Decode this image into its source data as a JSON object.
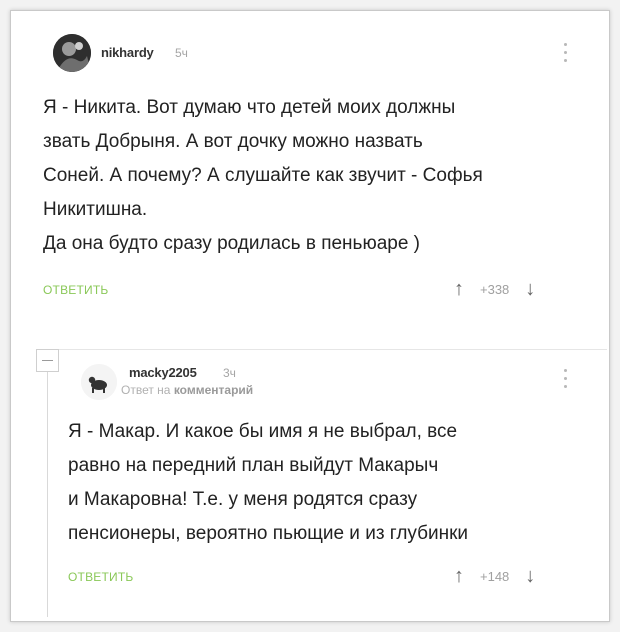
{
  "comments": [
    {
      "username": "nikhardy",
      "time": "5ч",
      "lines": [
        "Я - Никита. Вот думаю что детей моих должны",
        "звать Добрыня. А вот дочку можно назвать",
        "Соней. А почему? А слушайте как звучит - Софья",
        "Никитишна.",
        "Да она будто сразу родилась в пеньюаре )"
      ],
      "reply_label": "ОТВЕТИТЬ",
      "score": "+338",
      "avatar_icon": "user-avatar"
    },
    {
      "username": "macky2205",
      "time": "3ч",
      "reply_to_prefix": "Ответ на",
      "reply_to_target": "комментарий",
      "lines": [
        "Я - Макар. И какое бы имя я не выбрал, все",
        "равно на передний план выйдут Макарыч",
        "и Макаровна! Т.е. у меня родятся сразу",
        "пенсионеры, вероятно пьющие и из глубинки"
      ],
      "reply_label": "ОТВЕТИТЬ",
      "score": "+148",
      "avatar_icon": "user-avatar"
    }
  ],
  "icons": {
    "upvote": "↑",
    "downvote": "↓"
  },
  "colors": {
    "reply_link": "#8ac858",
    "muted": "#a5a5a5"
  }
}
